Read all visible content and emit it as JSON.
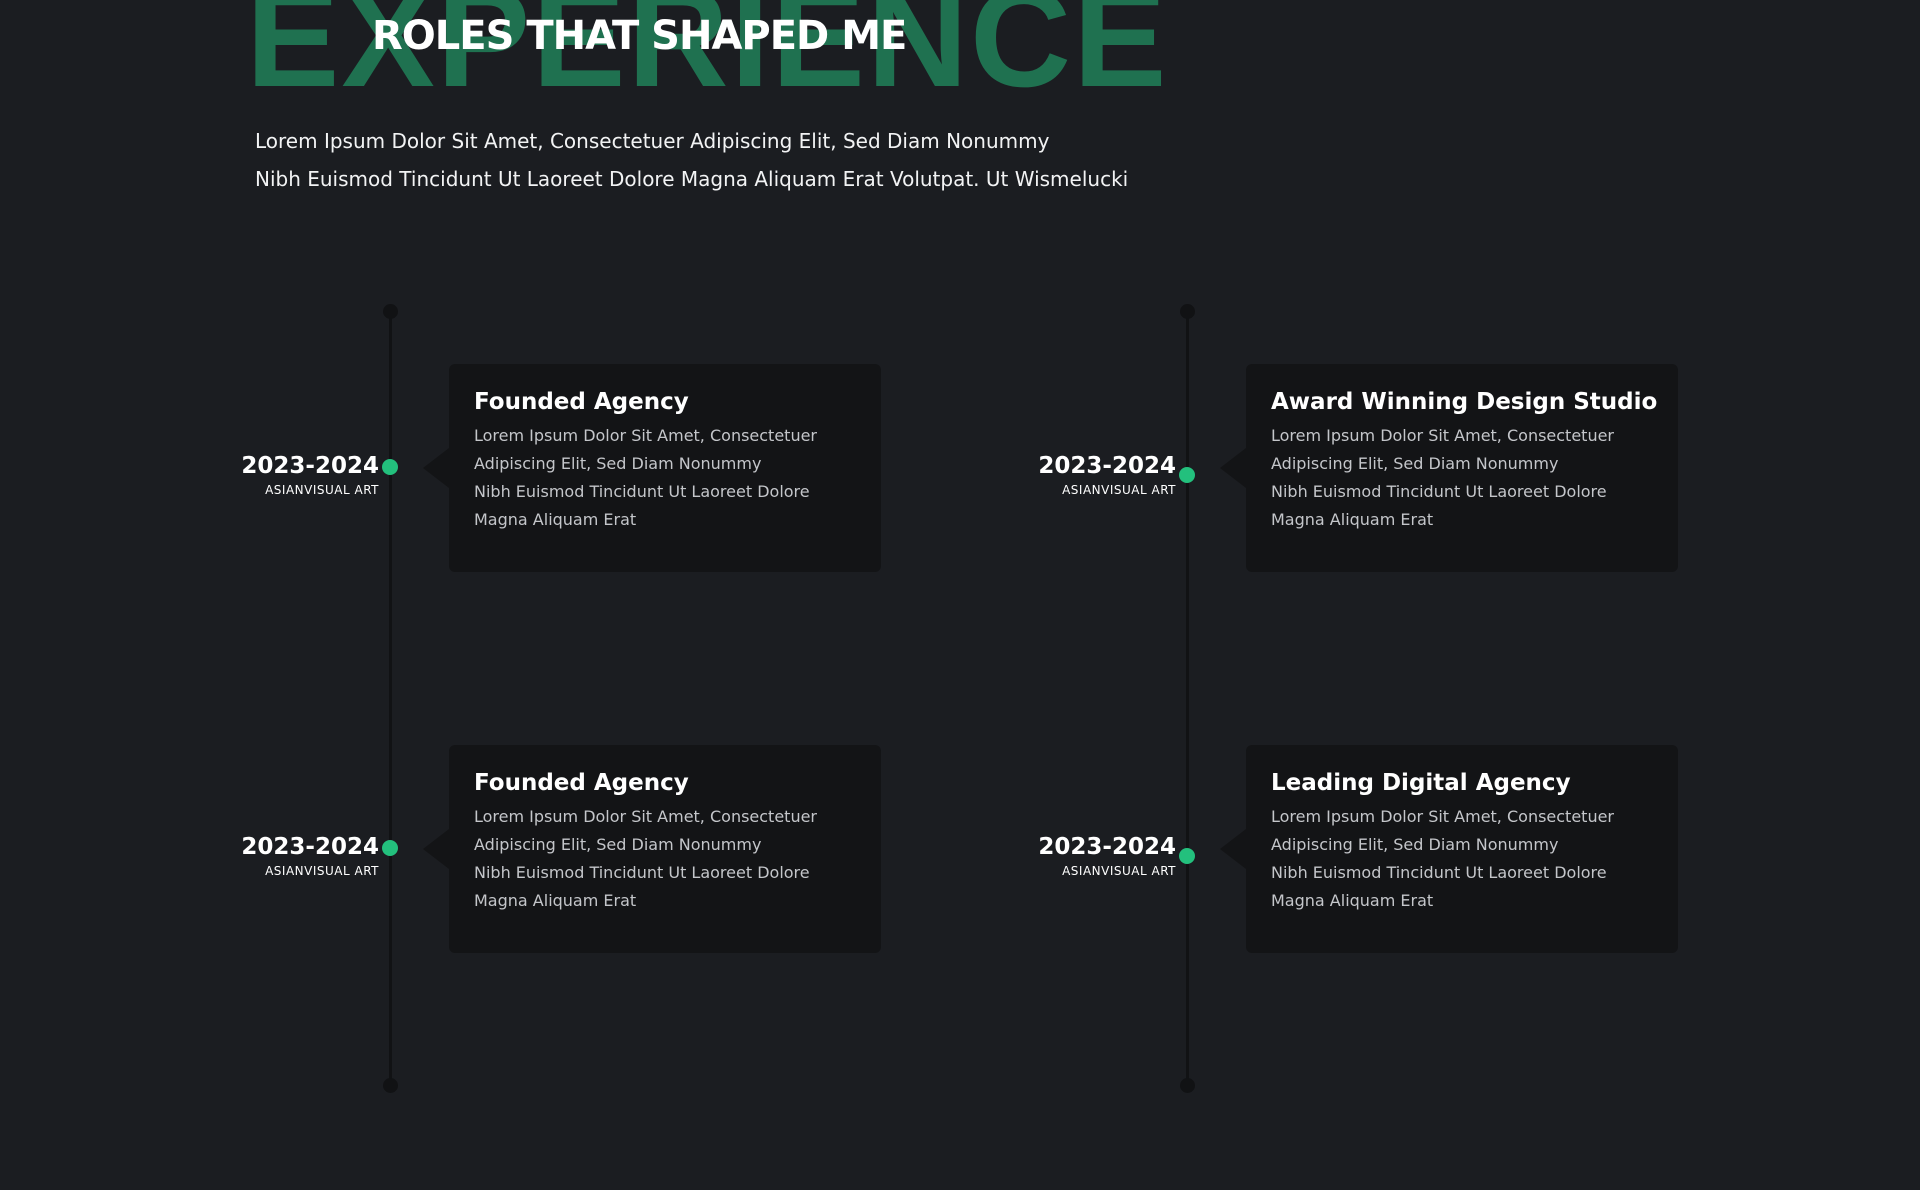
{
  "section": {
    "background_word": "EXPERIENCE",
    "title": "ROLES THAT SHAPED ME",
    "intro_lines": [
      "Lorem Ipsum Dolor Sit Amet, Consectetuer Adipiscing Elit, Sed Diam Nonummy",
      "Nibh Euismod Tincidunt Ut Laoreet Dolore Magna Aliquam Erat Volutpat. Ut Wismelucki"
    ]
  },
  "timeline": {
    "left": [
      {
        "year": "2023-2024",
        "company": "ASIANVISUAL ART",
        "title": "Founded Agency",
        "body_lines": [
          "Lorem Ipsum Dolor Sit Amet, Consectetuer",
          "Adipiscing Elit, Sed Diam Nonummy",
          "Nibh Euismod Tincidunt Ut Laoreet Dolore",
          "Magna Aliquam Erat"
        ]
      },
      {
        "year": "2023-2024",
        "company": "ASIANVISUAL ART",
        "title": "Founded Agency",
        "body_lines": [
          "Lorem Ipsum Dolor Sit Amet, Consectetuer",
          "Adipiscing Elit, Sed Diam Nonummy",
          "Nibh Euismod Tincidunt Ut Laoreet Dolore",
          "Magna Aliquam Erat"
        ]
      }
    ],
    "right": [
      {
        "year": "2023-2024",
        "company": "ASIANVISUAL ART",
        "title": "Award Winning Design Studio",
        "body_lines": [
          "Lorem Ipsum Dolor Sit Amet, Consectetuer",
          "Adipiscing Elit, Sed Diam Nonummy",
          "Nibh Euismod Tincidunt Ut Laoreet Dolore",
          "Magna Aliquam Erat"
        ]
      },
      {
        "year": "2023-2024",
        "company": "ASIANVISUAL ART",
        "title": "Leading Digital Agency",
        "body_lines": [
          "Lorem Ipsum Dolor Sit Amet, Consectetuer",
          "Adipiscing Elit, Sed Diam Nonummy",
          "Nibh Euismod Tincidunt Ut Laoreet Dolore",
          "Magna Aliquam Erat"
        ]
      }
    ]
  },
  "colors": {
    "page_background": "#1b1d21",
    "card_background": "#131416",
    "accent_green": "#23c07d",
    "background_word_green": "#1f7150",
    "axis_line": "#111214"
  }
}
